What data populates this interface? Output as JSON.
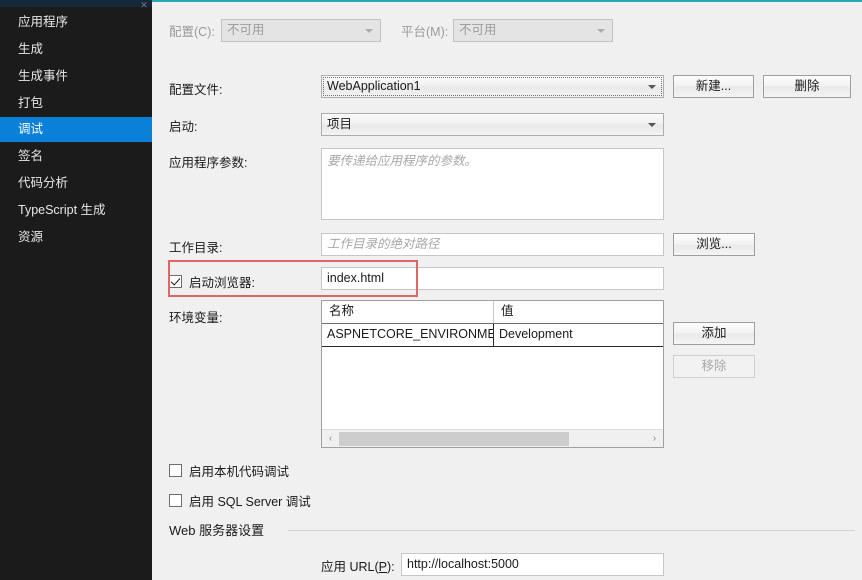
{
  "sidebar": {
    "items": [
      {
        "label": "应用程序",
        "selected": false
      },
      {
        "label": "生成",
        "selected": false
      },
      {
        "label": "生成事件",
        "selected": false
      },
      {
        "label": "打包",
        "selected": false
      },
      {
        "label": "调试",
        "selected": true
      },
      {
        "label": "签名",
        "selected": false
      },
      {
        "label": "代码分析",
        "selected": false
      },
      {
        "label": "TypeScript 生成",
        "selected": false
      },
      {
        "label": "资源",
        "selected": false
      }
    ],
    "close_icon": "✕",
    "selected_color": "#0a80d8",
    "background_color": "#1b1b1c"
  },
  "top_bar": {
    "configuration_label": "配置(C):",
    "configuration_value": "不可用",
    "platform_label": "平台(M):",
    "platform_value": "不可用"
  },
  "profile": {
    "label": "配置文件:",
    "value": "WebApplication1",
    "new_button": "新建...",
    "delete_button": "删除"
  },
  "launch": {
    "label": "启动:",
    "value": "项目"
  },
  "app_args": {
    "label": "应用程序参数:",
    "placeholder": "要传递给应用程序的参数。",
    "value": ""
  },
  "working_dir": {
    "label": "工作目录:",
    "placeholder": "工作目录的绝对路径",
    "value": "",
    "browse_button": "浏览..."
  },
  "launch_browser": {
    "label": "启动浏览器:",
    "checked": true,
    "value": "index.html"
  },
  "env_vars": {
    "label": "环境变量:",
    "columns": [
      "名称",
      "值"
    ],
    "rows": [
      {
        "name": "ASPNETCORE_ENVIRONMENT",
        "value": "Development"
      }
    ],
    "add_button": "添加",
    "remove_button": "移除",
    "scroll_left_icon": "‹",
    "scroll_right_icon": "›"
  },
  "debug_options": {
    "native_label": "启用本机代码调试",
    "native_checked": false,
    "sql_label": "启用 SQL Server 调试",
    "sql_checked": false
  },
  "web_server": {
    "group_title": "Web 服务器设置",
    "url_label_prefix": "应用 URL(",
    "url_label_accel": "P",
    "url_label_suffix": "):",
    "url_value": "http://localhost:5000"
  },
  "annotation": {
    "color": "#e06666"
  }
}
